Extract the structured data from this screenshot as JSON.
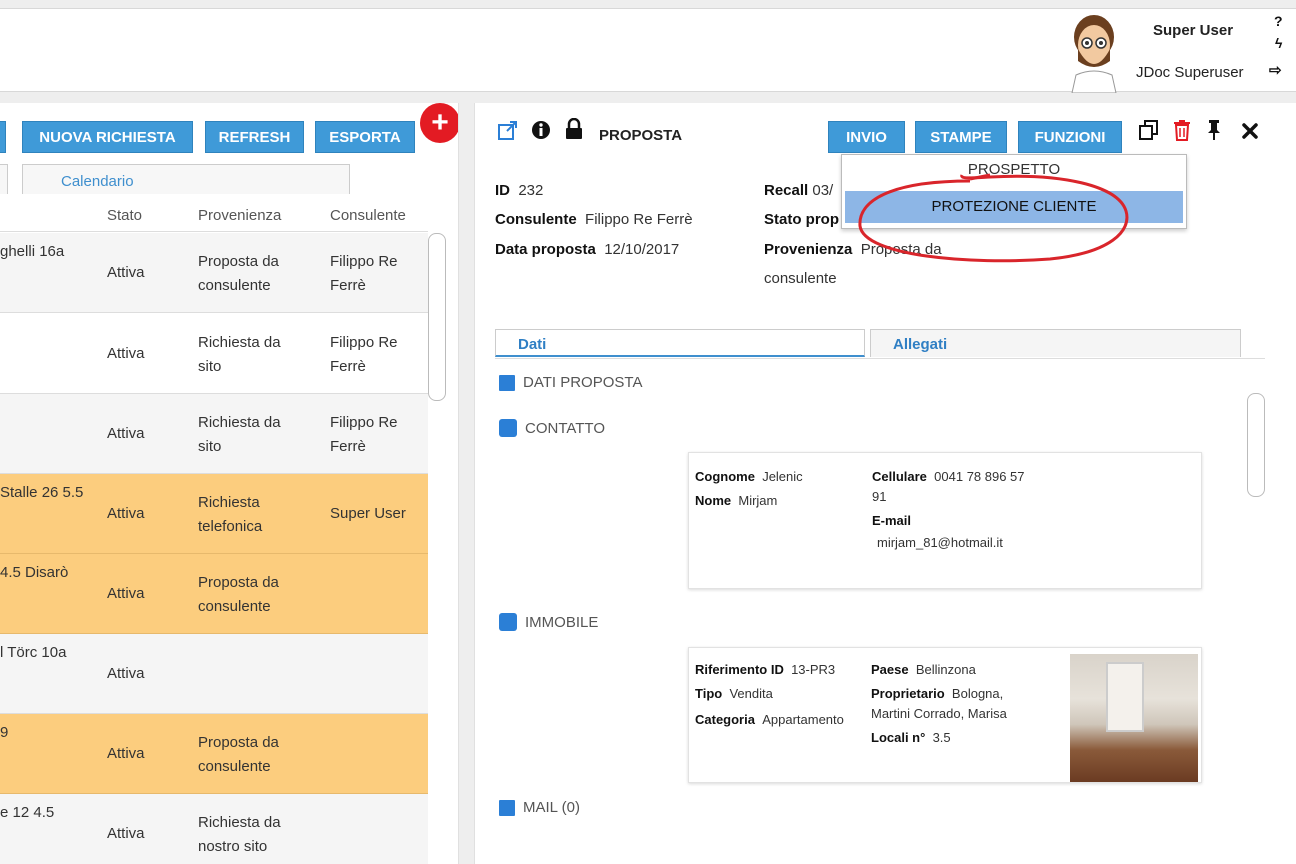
{
  "header": {
    "user_name": "Super User",
    "user_role": "JDoc Superuser",
    "help_glyph": "?",
    "bolt_glyph": "ϟ",
    "logout_glyph": "⇨"
  },
  "left": {
    "buttons": {
      "new_request": "NUOVA RICHIESTA",
      "refresh": "REFRESH",
      "export": "ESPORTA",
      "add": "+"
    },
    "tab_calendar": "Calendario",
    "columns": {
      "status": "Stato",
      "origin": "Provenienza",
      "consultant": "Consulente"
    },
    "rows": [
      {
        "address": "ghelli 16a",
        "status": "Attiva",
        "origin": [
          "Proposta da",
          "consulente"
        ],
        "consultant": [
          "Filippo Re",
          "Ferrè"
        ]
      },
      {
        "address": "",
        "status": "Attiva",
        "origin": [
          "Richiesta da",
          "sito"
        ],
        "consultant": [
          "Filippo Re",
          "Ferrè"
        ]
      },
      {
        "address": "",
        "status": "Attiva",
        "origin": [
          "Richiesta da",
          "sito"
        ],
        "consultant": [
          "Filippo Re",
          "Ferrè"
        ]
      },
      {
        "address": "Stalle 26 5.5",
        "status": "Attiva",
        "origin": [
          "Richiesta",
          "telefonica"
        ],
        "consultant": [
          "Super User",
          ""
        ]
      },
      {
        "address": "4.5 Disarò",
        "status": "Attiva",
        "origin": [
          "Proposta da",
          "consulente"
        ],
        "consultant": [
          "",
          ""
        ]
      },
      {
        "address": "l Törc 10a",
        "status": "Attiva",
        "origin": [
          "",
          ""
        ],
        "consultant": [
          "",
          ""
        ]
      },
      {
        "address": "9",
        "status": "Attiva",
        "origin": [
          "Proposta da",
          "consulente"
        ],
        "consultant": [
          "",
          ""
        ]
      },
      {
        "address": "e 12 4.5",
        "status": "Attiva",
        "origin": [
          "Richiesta da",
          "nostro sito"
        ],
        "consultant": [
          "",
          ""
        ]
      }
    ]
  },
  "right": {
    "title": "PROPOSTA",
    "buttons": {
      "send": "INVIO",
      "print": "STAMPE",
      "functions": "FUNZIONI"
    },
    "dropdown": {
      "item1": "PROSPETTO",
      "item2": "PROTEZIONE CLIENTE"
    },
    "fields": {
      "id_label": "ID",
      "id_value": "232",
      "consultant_label": "Consulente",
      "consultant_value": "Filippo Re Ferrè",
      "date_label": "Data proposta",
      "date_value": "12/10/2017",
      "recall_label": "Recall",
      "recall_value": "03/",
      "status_label": "Stato prop",
      "origin_label": "Provenienza",
      "origin_value": "Proposta da",
      "origin_value2": "consulente"
    },
    "tabs": {
      "data": "Dati",
      "attachments": "Allegati"
    },
    "sections": {
      "proposal": "DATI PROPOSTA",
      "contact": "CONTATTO",
      "property": "IMMOBILE",
      "mail": "MAIL (0)"
    },
    "contact": {
      "surname_label": "Cognome",
      "surname": "Jelenic",
      "name_label": "Nome",
      "name": "Mirjam",
      "mobile_label": "Cellulare",
      "mobile": "0041 78 896 57",
      "mobile2": "91",
      "email_label": "E-mail",
      "email": "mirjam_81@hotmail.it"
    },
    "property": {
      "ref_label": "Riferimento ID",
      "ref": "13-PR3",
      "type_label": "Tipo",
      "type": "Vendita",
      "cat_label": "Categoria",
      "cat": "Appartamento",
      "town_label": "Paese",
      "town": "Bellinzona",
      "owner_label": "Proprietario",
      "owner": "Bologna,",
      "owner2": "Martini Corrado, Marisa",
      "rooms_label": "Locali n°",
      "rooms": "3.5"
    },
    "accent_color": "#3f9ad8",
    "highlight_color": "#fccd7e"
  }
}
